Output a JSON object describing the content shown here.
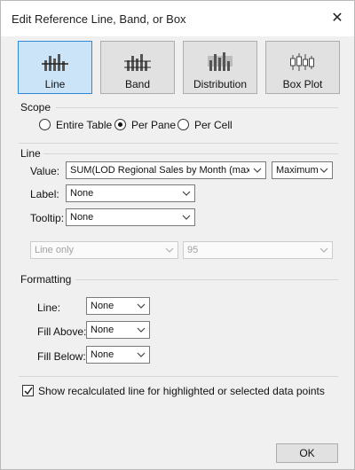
{
  "dialog": {
    "title": "Edit Reference Line, Band, or Box",
    "close_glyph": "✕"
  },
  "type_buttons": [
    {
      "label": "Line",
      "icon": "reference-line-icon",
      "selected": true
    },
    {
      "label": "Band",
      "icon": "reference-band-icon",
      "selected": false
    },
    {
      "label": "Distribution",
      "icon": "distribution-icon",
      "selected": false
    },
    {
      "label": "Box Plot",
      "icon": "box-plot-icon",
      "selected": false
    }
  ],
  "scope": {
    "heading": "Scope",
    "options": [
      {
        "label": "Entire Table",
        "checked": false
      },
      {
        "label": "Per Pane",
        "checked": true
      },
      {
        "label": "Per Cell",
        "checked": false
      }
    ]
  },
  "line": {
    "heading": "Line",
    "value_label": "Value:",
    "value_field": "SUM(LOD Regional Sales by Month (max))",
    "aggregation": "Maximum",
    "label_label": "Label:",
    "label_value": "None",
    "tooltip_label": "Tooltip:",
    "tooltip_value": "None",
    "line_option": "Line only",
    "confidence": "95"
  },
  "formatting": {
    "heading": "Formatting",
    "line_label": "Line:",
    "line_value": "None",
    "fill_above_label": "Fill Above:",
    "fill_above_value": "None",
    "fill_below_label": "Fill Below:",
    "fill_below_value": "None"
  },
  "recalculated": {
    "label": "Show recalculated line for highlighted or selected data points",
    "checked": true
  },
  "footer": {
    "ok_label": "OK"
  },
  "colors": {
    "selected_bg": "#cce4f7",
    "selected_border": "#2f88d4",
    "dialog_bg": "#f0f0f0"
  }
}
